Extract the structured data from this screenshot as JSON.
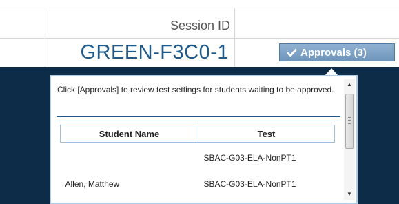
{
  "session": {
    "label": "Session ID",
    "id": "GREEN-F3C0-1"
  },
  "approvals_button": {
    "label": "Approvals (3)",
    "icon": "check-icon",
    "colors": {
      "background": "#7ea3c8",
      "text": "#ffffff"
    }
  },
  "popup": {
    "message": "Click [Approvals] to review test settings for students waiting to be approved.",
    "columns": [
      "Student Name",
      "Test"
    ],
    "rows": [
      {
        "name": "",
        "test": "SBAC-G03-ELA-NonPT1"
      },
      {
        "name": "Allen, Matthew",
        "test": "SBAC-G03-ELA-NonPT1"
      }
    ]
  },
  "colors": {
    "band": "#0c2c48",
    "accent": "#1f5a8a",
    "table_border": "#9cc0de"
  }
}
